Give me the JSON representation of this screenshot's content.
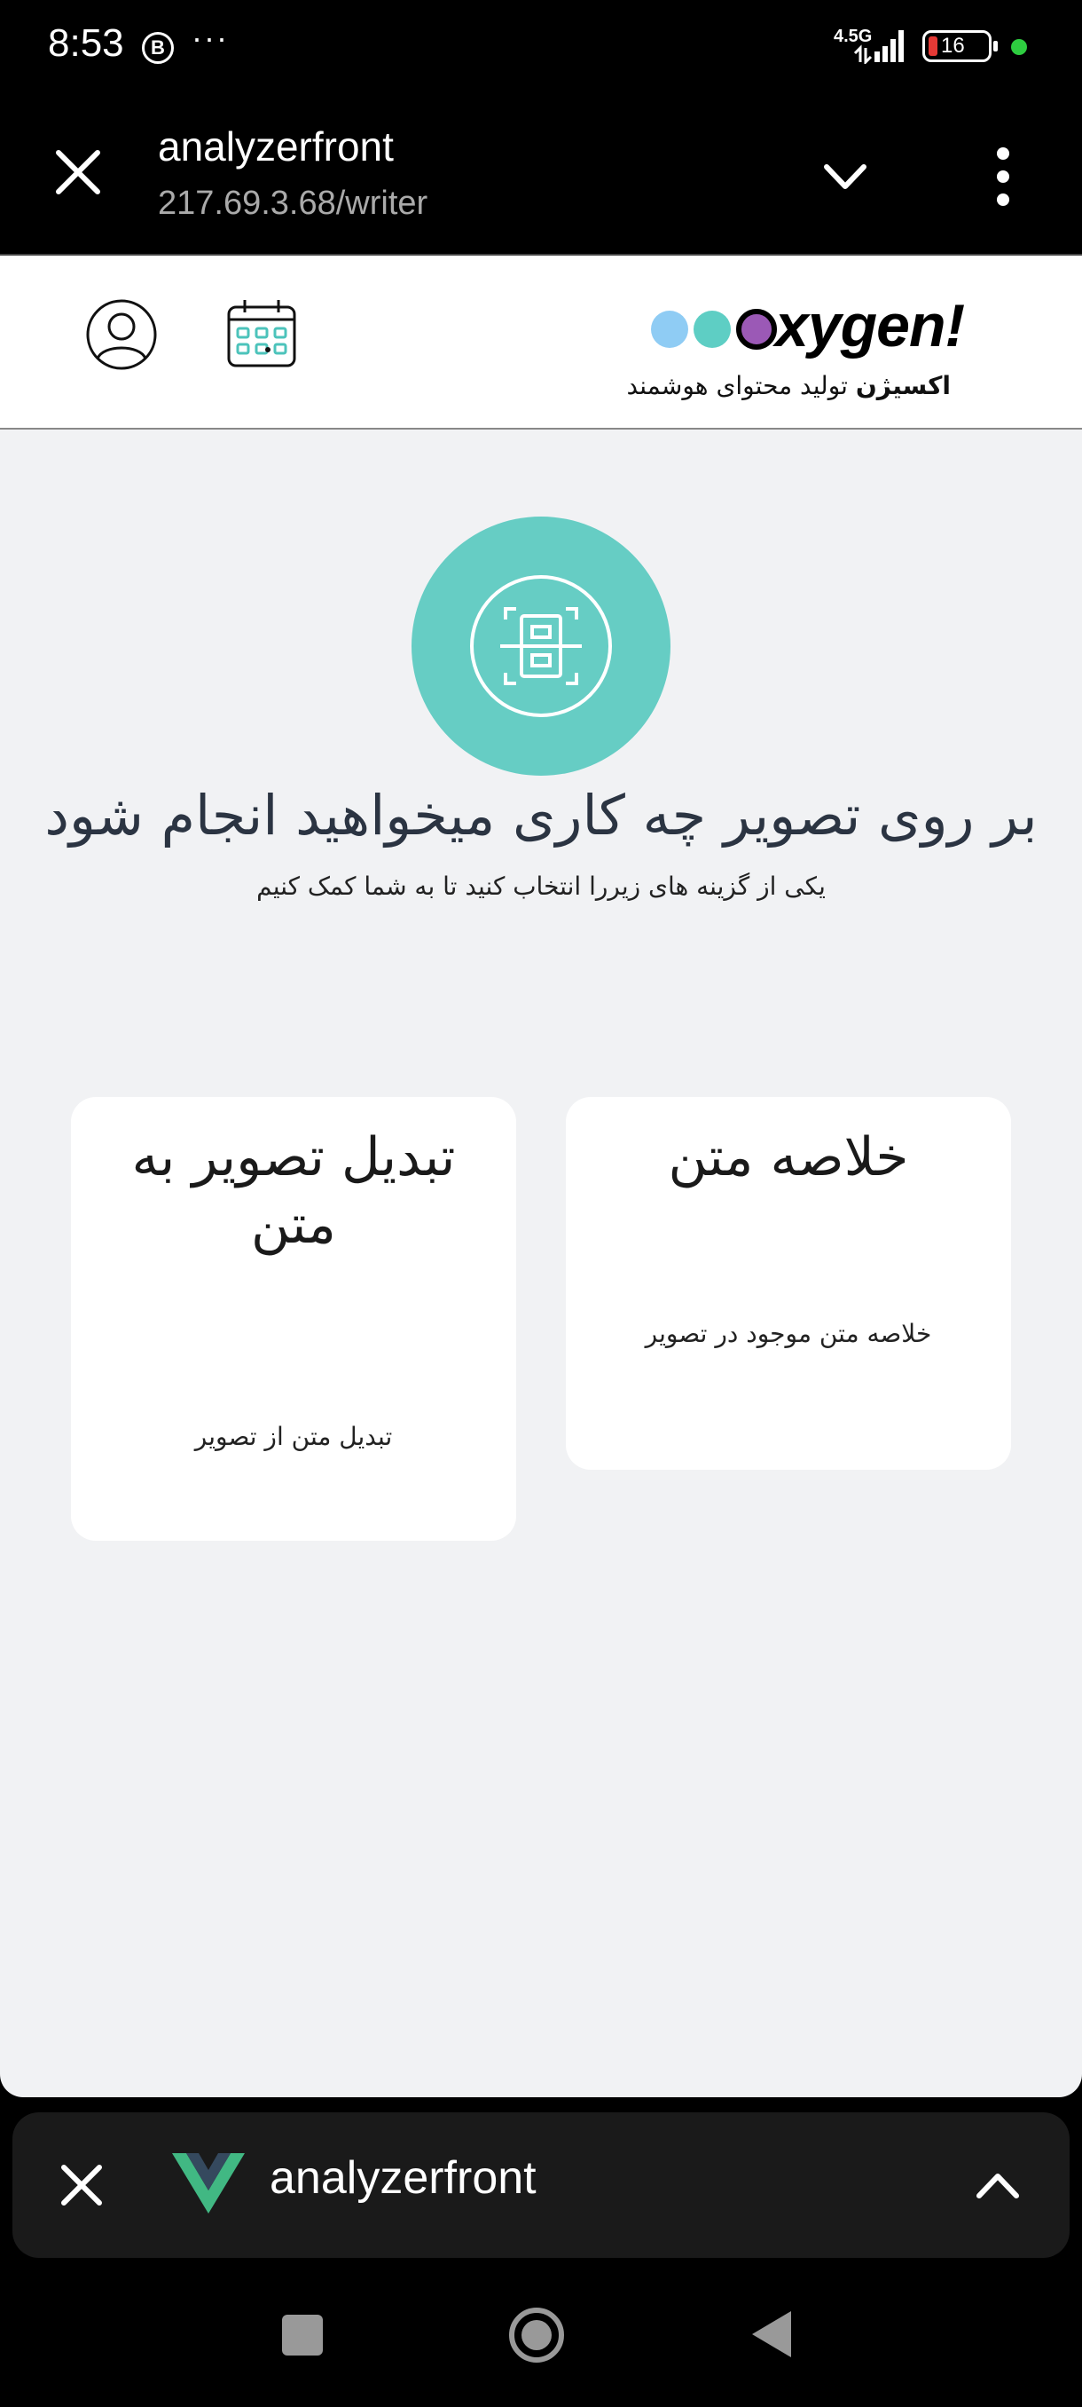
{
  "status_bar": {
    "time": "8:53",
    "b_badge": "B",
    "dots": "···",
    "network": "4.5G",
    "battery": "16",
    "icons": [
      "b-circle-icon",
      "signal-icon",
      "battery-icon",
      "green-dot-icon"
    ]
  },
  "browser_tab": {
    "title": "analyzerfront",
    "url": "217.69.3.68/writer",
    "icons": [
      "close-icon",
      "chevron-down-icon",
      "more-vert-icon"
    ]
  },
  "app_header": {
    "logo_text": "xygen!",
    "tagline_bold": "اکسیژن",
    "tagline_rest": " تولید محتوای هوشمند",
    "colors": {
      "dot1": "#8fccf4",
      "dot2": "#5ecec4",
      "dot3": "#9b59b6"
    },
    "icons": [
      "profile-icon",
      "calendar-icon"
    ]
  },
  "main": {
    "heading": "بر روی تصویر چه کاری میخواهید انجام شود",
    "subheading": "یکی از گزینه های زیررا انتخاب کنید تا به شما کمک کنیم",
    "hero_icon": "document-scan-icon",
    "accent_color": "#66cdc4",
    "cards": [
      {
        "title": "خلاصه متن",
        "description": "خلاصه متن موجود در تصویر"
      },
      {
        "title": "تبدیل تصویر به متن",
        "description": "تبدیل متن از تصویر"
      }
    ]
  },
  "bottom_bar": {
    "title": "analyzerfront",
    "icons": [
      "close-icon",
      "vue-logo-icon",
      "chevron-up-icon"
    ]
  },
  "nav_bar": {
    "icons": [
      "recents-icon",
      "home-icon",
      "back-icon"
    ]
  }
}
